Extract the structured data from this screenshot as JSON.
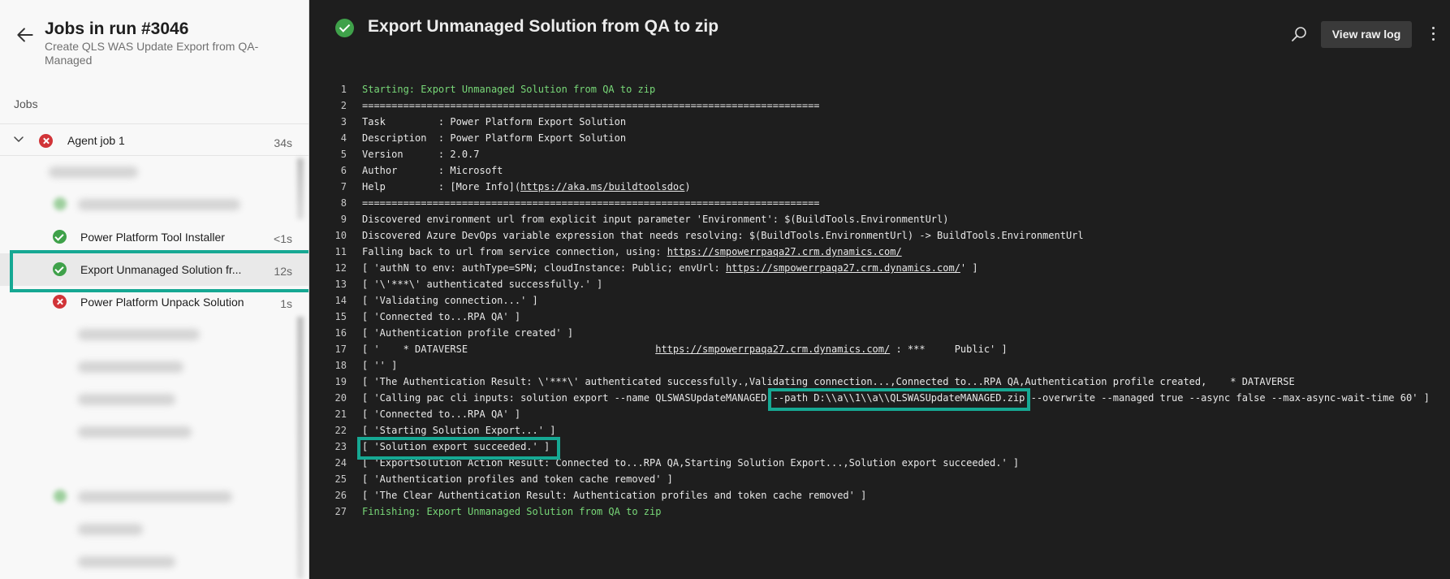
{
  "left": {
    "title": "Jobs in run #3046",
    "subtitle": "Create QLS WAS Update Export from QA-Managed",
    "jobs_heading": "Jobs",
    "agent_job": {
      "name": "Agent job 1",
      "duration": "34s",
      "status": "failed"
    },
    "steps": [
      {
        "name": "Power Platform Tool Installer",
        "duration": "<1s",
        "status": "succeeded"
      },
      {
        "name": "Export Unmanaged Solution fr...",
        "duration": "12s",
        "status": "succeeded",
        "selected": true
      },
      {
        "name": "Power Platform Unpack Solution",
        "duration": "1s",
        "status": "failed"
      }
    ]
  },
  "header": {
    "title": "Export Unmanaged Solution from QA to zip",
    "view_raw_label": "View raw log",
    "icons": [
      "back-arrow-icon",
      "search-icon",
      "more-icon",
      "check-icon",
      "error-icon"
    ]
  },
  "colors": {
    "success": "#3fa14a",
    "error": "#d13438",
    "highlight": "#16a893",
    "log_bg": "#1e1e1e",
    "log_green": "#78d878"
  },
  "log": [
    {
      "n": "1",
      "text": "Starting: Export Unmanaged Solution from QA to zip",
      "green": true
    },
    {
      "n": "2",
      "text": "=============================================================================="
    },
    {
      "n": "3",
      "text": "Task         : Power Platform Export Solution"
    },
    {
      "n": "4",
      "text": "Description  : Power Platform Export Solution"
    },
    {
      "n": "5",
      "text": "Version      : 2.0.7"
    },
    {
      "n": "6",
      "text": "Author       : Microsoft"
    },
    {
      "n": "7",
      "pre": "Help         : [More Info](",
      "link": "https://aka.ms/buildtoolsdoc",
      "post": ")"
    },
    {
      "n": "8",
      "text": "=============================================================================="
    },
    {
      "n": "9",
      "text": "Discovered environment url from explicit input parameter 'Environment': $(BuildTools.EnvironmentUrl)"
    },
    {
      "n": "10",
      "text": "Discovered Azure DevOps variable expression that needs resolving: $(BuildTools.EnvironmentUrl) -> BuildTools.EnvironmentUrl"
    },
    {
      "n": "11",
      "pre": "Falling back to url from service connection, using: ",
      "link": "https://smpowerrpaqa27.crm.dynamics.com/",
      "post": ""
    },
    {
      "n": "12",
      "pre": "[ 'authN to env: authType=SPN; cloudInstance: Public; envUrl: ",
      "link": "https://smpowerrpaqa27.crm.dynamics.com/",
      "post": "' ]"
    },
    {
      "n": "13",
      "text": "[ '\\'***\\' authenticated successfully.' ]"
    },
    {
      "n": "14",
      "text": "[ 'Validating connection...' ]"
    },
    {
      "n": "15",
      "text": "[ 'Connected to...RPA QA' ]"
    },
    {
      "n": "16",
      "text": "[ 'Authentication profile created' ]"
    },
    {
      "n": "17",
      "pre": "[ '    * DATAVERSE                                ",
      "link": "https://smpowerrpaqa27.crm.dynamics.com/",
      "post": " : ***     Public' ]"
    },
    {
      "n": "18",
      "text": "[ '' ]"
    },
    {
      "n": "19",
      "text": "[ 'The Authentication Result: \\'***\\' authenticated successfully.,Validating connection...,Connected to...RPA QA,Authentication profile created,    * DATAVERSE"
    },
    {
      "n": "20",
      "text": "[ 'Calling pac cli inputs: solution export --name QLSWASUpdateMANAGED --path D:\\\\a\\\\1\\\\a\\\\QLSWASUpdateMANAGED.zip --overwrite --managed true --async false --max-async-wait-time 60' ]"
    },
    {
      "n": "21",
      "text": "[ 'Connected to...RPA QA' ]"
    },
    {
      "n": "22",
      "text": "[ 'Starting Solution Export...' ]"
    },
    {
      "n": "23",
      "text": "[ 'Solution export succeeded.' ]"
    },
    {
      "n": "24",
      "text": "[ 'ExportSolution Action Result: Connected to...RPA QA,Starting Solution Export...,Solution export succeeded.' ]"
    },
    {
      "n": "25",
      "text": "[ 'Authentication profiles and token cache removed' ]"
    },
    {
      "n": "26",
      "text": "[ 'The Clear Authentication Result: Authentication profiles and token cache removed' ]"
    },
    {
      "n": "27",
      "text": "Finishing: Export Unmanaged Solution from QA to zip",
      "green": true
    }
  ]
}
